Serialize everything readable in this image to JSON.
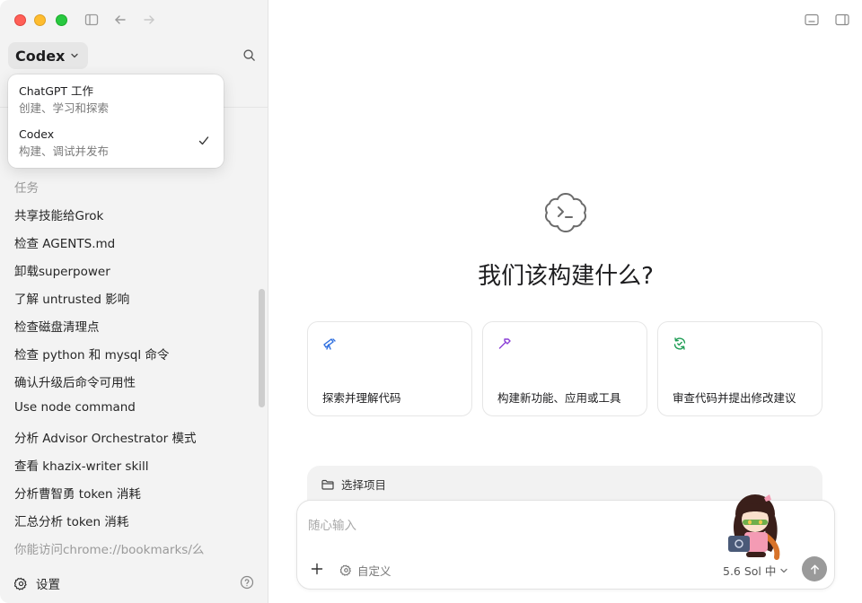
{
  "sidebar": {
    "app_switcher": {
      "label": "Codex"
    },
    "menu": [
      {
        "title": "ChatGPT 工作",
        "subtitle": "创建、学习和探索",
        "checked": false
      },
      {
        "title": "Codex",
        "subtitle": "构建、调试并发布",
        "checked": true
      }
    ],
    "tasks_header": "任务",
    "tasks": [
      "共享技能给Grok",
      "检查 AGENTS.md",
      "卸载superpower",
      "了解 untrusted 影响",
      "检查磁盘清理点",
      "检查 python 和 mysql 命令",
      "确认升级后命令可用性",
      "Use node command",
      "分析 Advisor Orchestrator 模式",
      "查看 khazix-writer skill",
      "分析曹智勇 token 消耗",
      "汇总分析 token 消耗",
      "你能访问chrome://bookmarks/么"
    ],
    "settings_label": "设置"
  },
  "main": {
    "headline": "我们该构建什么?",
    "cards": [
      {
        "label": "探索并理解代码",
        "icon": "telescope-icon",
        "color": "#2f6fdf"
      },
      {
        "label": "构建新功能、应用或工具",
        "icon": "hammer-icon",
        "color": "#8a3ed6"
      },
      {
        "label": "审查代码并提出修改建议",
        "icon": "refresh-check-icon",
        "color": "#1f9d55"
      }
    ],
    "project_selector": "选择项目",
    "composer": {
      "placeholder": "随心输入",
      "custom_label": "自定义",
      "model_label": "5.6 Sol 中"
    }
  },
  "colors": {
    "sidebar_bg": "#f3f3f3",
    "accent_blue": "#2f6fdf",
    "accent_purple": "#8a3ed6",
    "accent_green": "#1f9d55",
    "send_button": "#9a9a9a"
  }
}
